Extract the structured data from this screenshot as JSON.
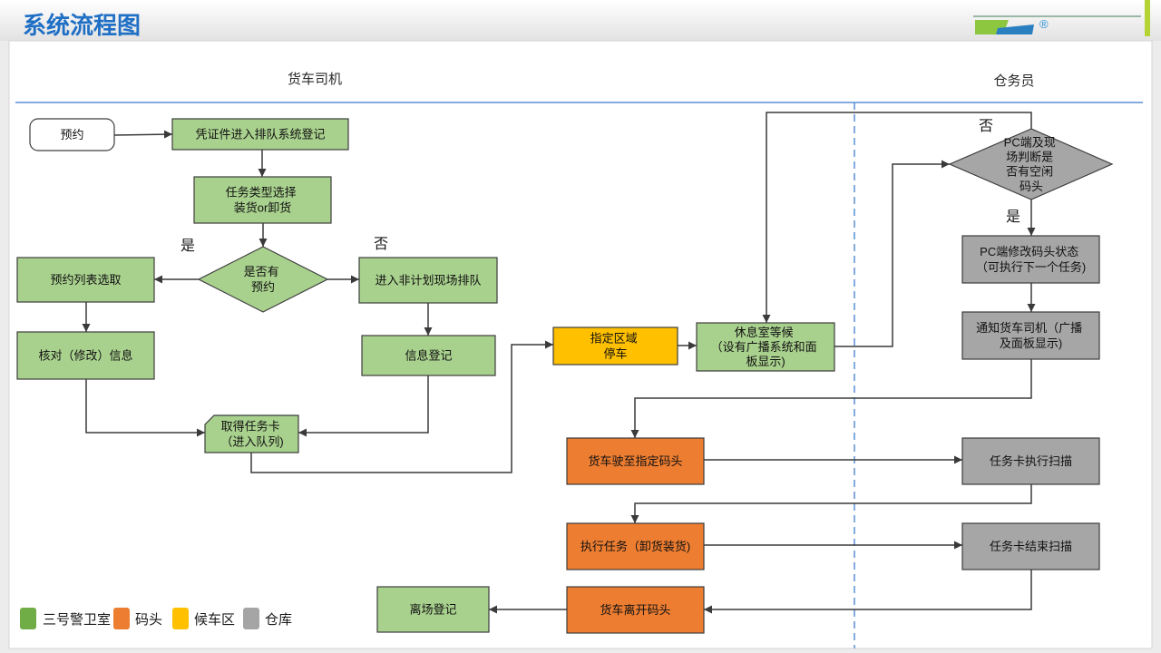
{
  "header": {
    "title": "系统流程图",
    "logo_mark": "®"
  },
  "lanes": {
    "driver": "货车司机",
    "warehouse_staff": "仓务员"
  },
  "palette": {
    "title": "#1f6fc5",
    "start_box": "#ffffff",
    "guard_room_box": "#a9d18e",
    "dock_box": "#ed7d31",
    "waiting_area_box": "#ffc000",
    "warehouse_box": "#a6a6a6",
    "lane_rule": "#5b8fd6"
  },
  "nodes": {
    "appointment": [
      "预约"
    ],
    "check_in": [
      "凭证件进入排队系统登记"
    ],
    "task_type": [
      "任务类型选择",
      "装货or卸货"
    ],
    "has_appointment": [
      "是否有",
      "预约"
    ],
    "select_from_list": [
      "预约列表选取"
    ],
    "unplanned_queue": [
      "进入非计划现场排队"
    ],
    "verify_info": [
      "核对（修改）信息"
    ],
    "register_info": [
      "信息登记"
    ],
    "get_task_card": [
      "取得任务卡",
      "（进入队列)"
    ],
    "park_in_zone": [
      "指定区域",
      "停车"
    ],
    "lounge_wait": [
      "休息室等候",
      "（设有广播系统和面",
      "板显示)"
    ],
    "dock_available": [
      "PC端及现",
      "场判断是",
      "否有空闲",
      "码头"
    ],
    "update_dock_status": [
      "PC端修改码头状态",
      "（可执行下一个任务)"
    ],
    "notify_driver": [
      "通知货车司机（广播",
      "及面板显示)"
    ],
    "drive_to_dock": [
      "货车驶至指定码头"
    ],
    "scan_task_start": [
      "任务卡执行扫描"
    ],
    "execute_task": [
      "执行任务（卸货装货)"
    ],
    "scan_task_end": [
      "任务卡结束扫描"
    ],
    "leave_dock": [
      "货车离开码头"
    ],
    "exit_register": [
      "离场登记"
    ]
  },
  "branch_labels": {
    "appointment_yes": "是",
    "appointment_no": "否",
    "dock_no": "否",
    "dock_yes": "是"
  },
  "legend": [
    {
      "label": "三号警卫室",
      "color": "#70ad47"
    },
    {
      "label": "码头",
      "color": "#ed7d31"
    },
    {
      "label": "候车区",
      "color": "#ffc000"
    },
    {
      "label": "仓库",
      "color": "#a5a5a5"
    }
  ]
}
